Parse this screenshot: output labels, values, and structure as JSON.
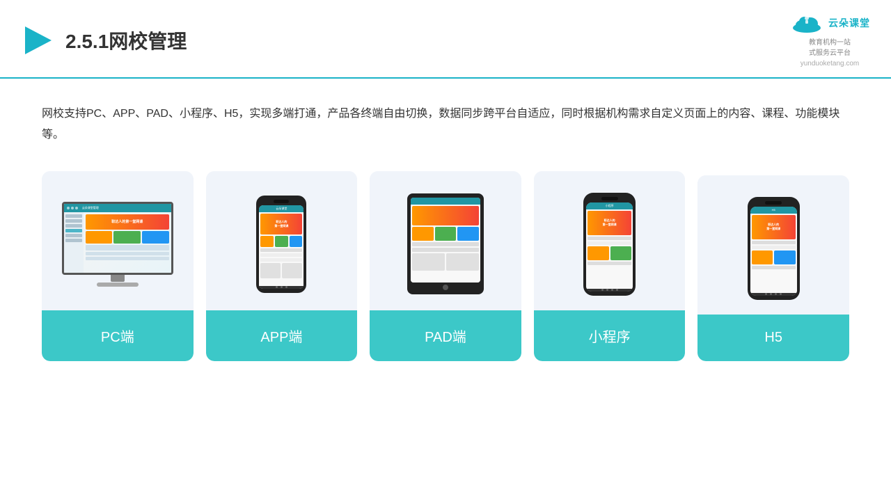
{
  "header": {
    "title": "2.5.1网校管理",
    "logo_main": "云朵课堂",
    "logo_url": "yunduoketang.com",
    "logo_sub": "教育机构一站\n式服务云平台"
  },
  "description": "网校支持PC、APP、PAD、小程序、H5，实现多端打通，产品各终端自由切换，数据同步跨平台自适应，同时根据机构需求自定义页面上的内容、课程、功能模块等。",
  "cards": [
    {
      "id": "pc",
      "label": "PC端"
    },
    {
      "id": "app",
      "label": "APP端"
    },
    {
      "id": "pad",
      "label": "PAD端"
    },
    {
      "id": "miniapp",
      "label": "小程序"
    },
    {
      "id": "h5",
      "label": "H5"
    }
  ],
  "accent_color": "#3cc8c8",
  "accent_color2": "#1ab3c8"
}
